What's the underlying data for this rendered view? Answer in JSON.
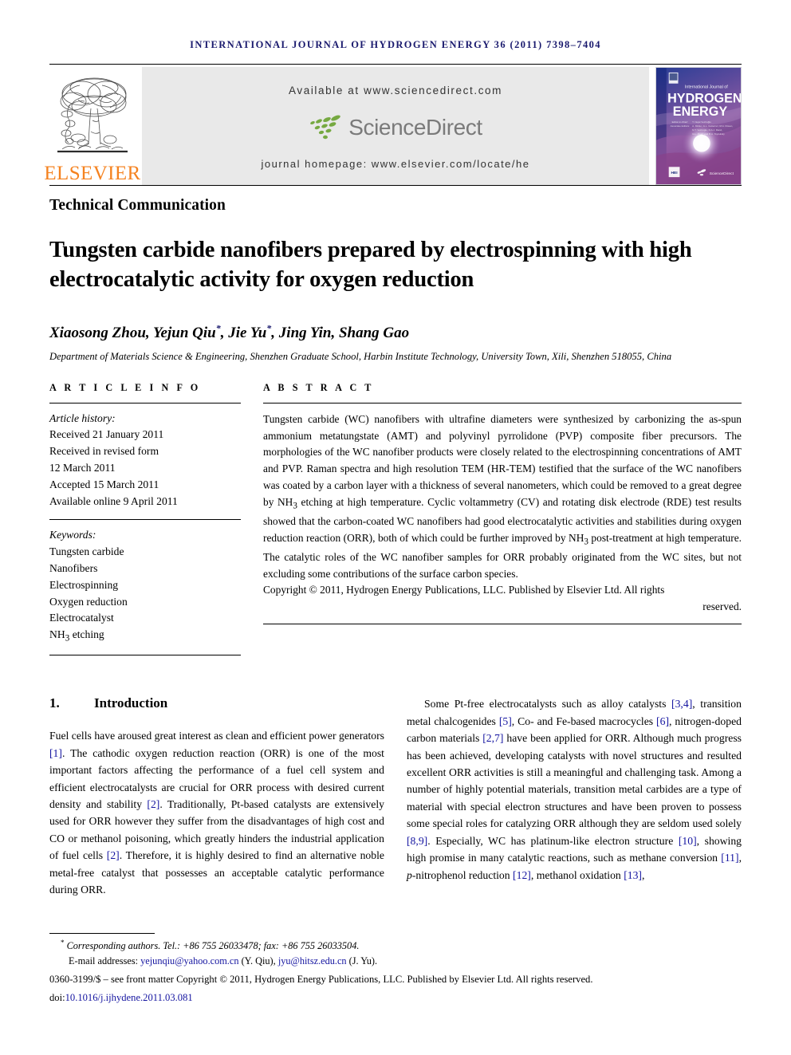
{
  "running_head": "INTERNATIONAL JOURNAL OF HYDROGEN ENERGY 36 (2011) 7398–7404",
  "masthead": {
    "publisher_name": "ELSEVIER",
    "available_at": "Available at www.sciencedirect.com",
    "sciencedirect_word": "ScienceDirect",
    "journal_homepage": "journal homepage: www.elsevier.com/locate/he",
    "cover": {
      "line1": "International Journal of",
      "line2": "HYDROGEN",
      "line3": "ENERGY",
      "editor_block": "Editor-in-Chief: T. Nejat Veziroğlu    Associate Editors: A. Müller, G.L. Gutierrez, M.A. Rosen, N.T. Veziroglu, D.A.J. Rand, G.L. Zwart and B.A. Tsybulsky",
      "sciencedirect_footer": "ScienceDirect",
      "hei_badge": "HEI"
    }
  },
  "article": {
    "type": "Technical Communication",
    "title": "Tungsten carbide nanofibers prepared by electrospinning with high electrocatalytic activity for oxygen reduction",
    "authors_html": "Xiaosong Zhou, Yejun Qiu*, Jie Yu*, Jing Yin, Shang Gao",
    "authors_plain": "Xiaosong Zhou, Yejun Qiu*, Jie Yu*, Jing Yin, Shang Gao",
    "affiliation": "Department of Materials Science & Engineering, Shenzhen Graduate School, Harbin Institute Technology, University Town, Xili, Shenzhen 518055, China"
  },
  "info": {
    "heading": "A R T I C L E   I N F O",
    "history_label": "Article history:",
    "history": [
      "Received 21 January 2011",
      "Received in revised form",
      "12 March 2011",
      "Accepted 15 March 2011",
      "Available online 9 April 2011"
    ],
    "keywords_label": "Keywords:",
    "keywords": [
      "Tungsten carbide",
      "Nanofibers",
      "Electrospinning",
      "Oxygen reduction",
      "Electrocatalyst",
      "NH3 etching"
    ]
  },
  "abstract": {
    "heading": "A B S T R A C T",
    "text": "Tungsten carbide (WC) nanofibers with ultrafine diameters were synthesized by carbonizing the as-spun ammonium metatungstate (AMT) and polyvinyl pyrrolidone (PVP) composite fiber precursors. The morphologies of the WC nanofiber products were closely related to the electrospinning concentrations of AMT and PVP. Raman spectra and high resolution TEM (HR-TEM) testified that the surface of the WC nanofibers was coated by a carbon layer with a thickness of several nanometers, which could be removed to a great degree by NH3 etching at high temperature. Cyclic voltammetry (CV) and rotating disk electrode (RDE) test results showed that the carbon-coated WC nanofibers had good electrocatalytic activities and stabilities during oxygen reduction reaction (ORR), both of which could be further improved by NH3 post-treatment at high temperature. The catalytic roles of the WC nanofiber samples for ORR probably originated from the WC sites, but not excluding some contributions of the surface carbon species.",
    "copyright_main": "Copyright © 2011, Hydrogen Energy Publications, LLC. Published by Elsevier Ltd. All rights",
    "copyright_tail": "reserved."
  },
  "body": {
    "section_number": "1.",
    "section_title": "Introduction",
    "left_paragraph": "Fuel cells have aroused great interest as clean and efficient power generators [1]. The cathodic oxygen reduction reaction (ORR) is one of the most important factors affecting the performance of a fuel cell system and efficient electrocatalysts are crucial for ORR process with desired current density and stability [2]. Traditionally, Pt-based catalysts are extensively used for ORR however they suffer from the disadvantages of high cost and CO or methanol poisoning, which greatly hinders the industrial application of fuel cells [2]. Therefore, it is highly desired to find an alternative noble metal-free catalyst that possesses an acceptable catalytic performance during ORR.",
    "right_paragraph": "Some Pt-free electrocatalysts such as alloy catalysts [3,4], transition metal chalcogenides [5], Co- and Fe-based macrocycles [6], nitrogen-doped carbon materials [2,7] have been applied for ORR. Although much progress has been achieved, developing catalysts with novel structures and resulted excellent ORR activities is still a meaningful and challenging task. Among a number of highly potential materials, transition metal carbides are a type of material with special electron structures and have been proven to possess some special roles for catalyzing ORR although they are seldom used solely [8,9]. Especially, WC has platinum-like electron structure [10], showing high promise in many catalytic reactions, such as methane conversion [11], p-nitrophenol reduction [12], methanol oxidation [13],"
  },
  "footer": {
    "corresponding": "Corresponding authors. Tel.: +86 755 26033478; fax: +86 755 26033504.",
    "email_label": "E-mail addresses:",
    "email1": "yejunqiu@yahoo.com.cn",
    "email1_owner": "(Y. Qiu),",
    "email2": "jyu@hitsz.edu.cn",
    "email2_owner": "(J. Yu).",
    "issn_line": "0360-3199/$ – see front matter Copyright © 2011, Hydrogen Energy Publications, LLC. Published by Elsevier Ltd. All rights reserved.",
    "doi_label": "doi:",
    "doi_value": "10.1016/j.ijhydene.2011.03.081"
  },
  "colors": {
    "running_head": "#1a1a6e",
    "elsevier_orange": "#F5821F",
    "citation_blue": "#1414a0",
    "banner_gray": "#e9e9e9",
    "sciencedirect_green": "#76a941",
    "sciencedirect_gray": "#7a7a7a"
  }
}
